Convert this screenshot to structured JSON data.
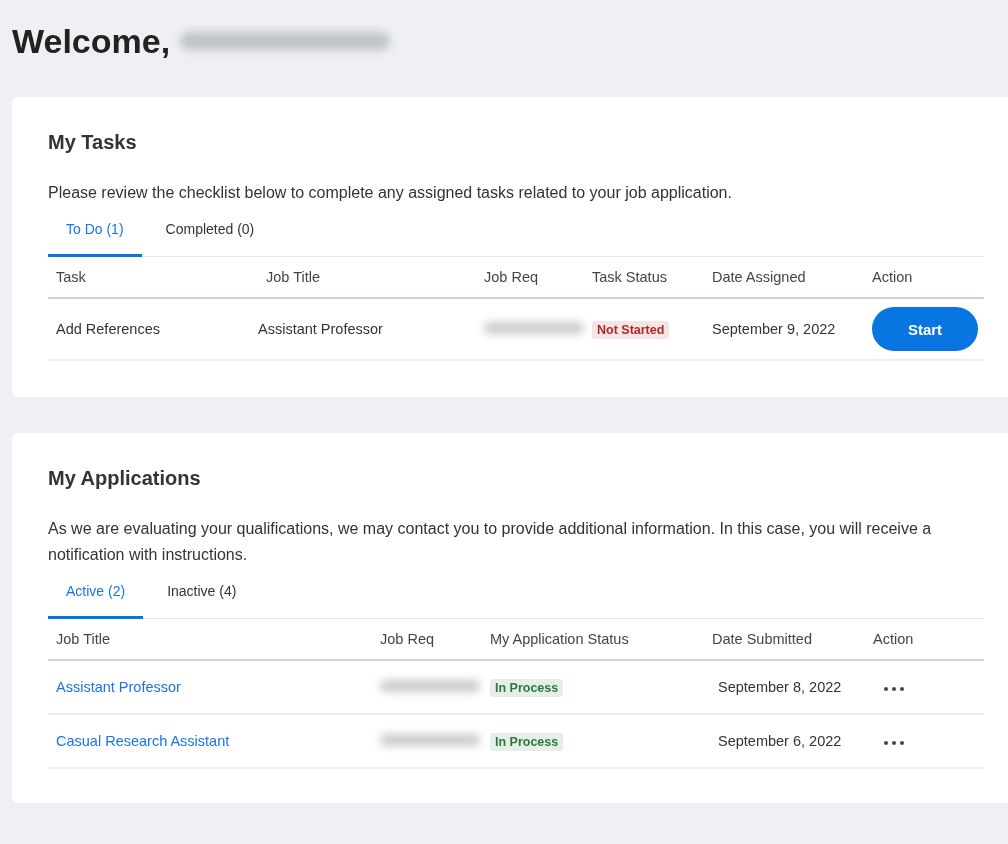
{
  "welcome": {
    "greeting": "Welcome,",
    "name_redacted": true
  },
  "tasks": {
    "title": "My Tasks",
    "description": "Please review the checklist below to complete any assigned tasks related to your job application.",
    "tabs": [
      {
        "label": "To Do (1)",
        "selected": true
      },
      {
        "label": "Completed (0)",
        "selected": false
      }
    ],
    "columns": [
      "Task",
      "Job Title",
      "Job Req",
      "Task Status",
      "Date Assigned",
      "Action"
    ],
    "rows": [
      {
        "task": "Add References",
        "job_title": "Assistant Professor",
        "job_req_redacted": true,
        "status": "Not Started",
        "color": "#b0282d",
        "date": "September 9, 2022",
        "action": "Start"
      }
    ]
  },
  "applications": {
    "title": "My Applications",
    "description": "As we are evaluating your qualifications, we may contact you to provide additional information. In this case, you will receive a notification with instructions.",
    "tabs": [
      {
        "label": "Active (2)",
        "selected": true
      },
      {
        "label": "Inactive (4)",
        "selected": false
      }
    ],
    "columns": [
      "Job Title",
      "Job Req",
      "My Application Status",
      "Date Submitted",
      "Action"
    ],
    "rows": [
      {
        "job_title": "Assistant Professor",
        "job_req_redacted": true,
        "status": "In Process",
        "color": "#2b7a3b",
        "date": "September 8, 2022"
      },
      {
        "job_title": "Casual Research Assistant",
        "job_req_redacted": true,
        "status": "In Process",
        "color": "#2b7a3b",
        "date": "September 6, 2022"
      }
    ]
  }
}
